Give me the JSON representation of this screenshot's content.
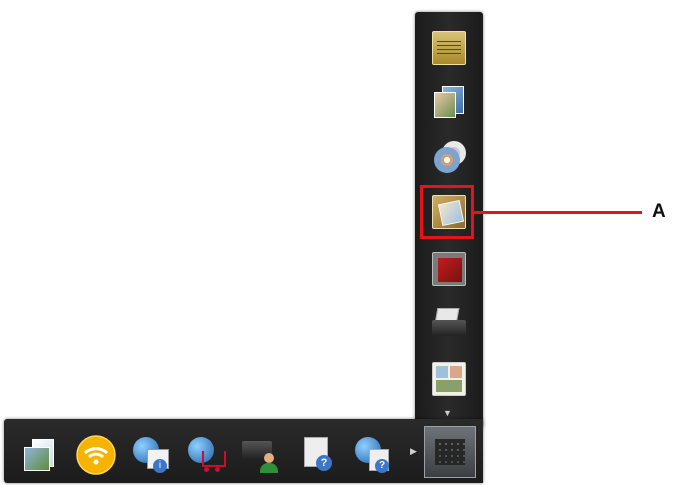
{
  "callout": {
    "label": "A",
    "color": "#e5141a"
  },
  "vertical_apps": [
    {
      "icon": "creative-park-premium-icon"
    },
    {
      "icon": "photo-layout-icon"
    },
    {
      "icon": "disc-label-icon"
    },
    {
      "icon": "highlighted-app-icon",
      "highlighted": true
    },
    {
      "icon": "photo-print-icon"
    },
    {
      "icon": "printer-scanner-icon"
    },
    {
      "icon": "photo-collage-icon"
    }
  ],
  "horizontal_apps": [
    {
      "icon": "scan-documents-icon"
    },
    {
      "icon": "wireless-connection-icon"
    },
    {
      "icon": "web-info-icon"
    },
    {
      "icon": "online-shop-icon"
    },
    {
      "icon": "printer-user-icon"
    },
    {
      "icon": "help-document-icon"
    },
    {
      "icon": "web-help-icon"
    }
  ],
  "colors": {
    "panel": "#1f1f1f",
    "accent": "#e5141a",
    "wifi": "#f5b400"
  }
}
